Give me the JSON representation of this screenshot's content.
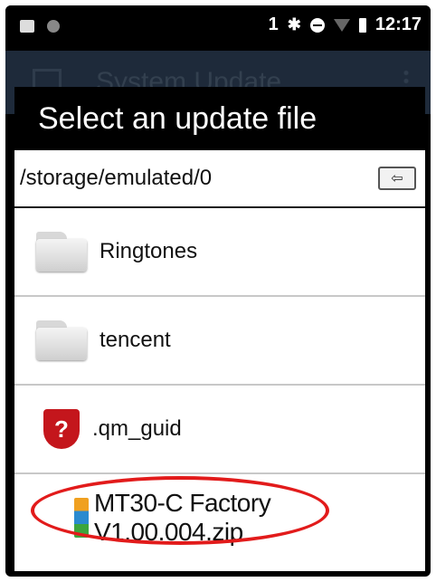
{
  "status_bar": {
    "sim_number": "1",
    "time": "12:17",
    "icons": [
      "gallery-icon",
      "notification-dot-icon",
      "bluetooth-icon",
      "dnd-icon",
      "wifi-icon",
      "battery-icon"
    ]
  },
  "background_app": {
    "title": "System Update"
  },
  "dialog": {
    "title": "Select an update file",
    "path": "/storage/emulated/0",
    "up_button_icon": "back-arrow-icon",
    "items": [
      {
        "label": "Ringtones",
        "icon": "folder-icon"
      },
      {
        "label": "tencent",
        "icon": "folder-icon"
      },
      {
        "label": ".qm_guid",
        "icon": "security-shield-icon"
      },
      {
        "label": "MT30-C Factory V1.00.004.zip",
        "icon": "zip-archive-icon"
      }
    ]
  },
  "annotation": {
    "color": "#e21b1b"
  }
}
